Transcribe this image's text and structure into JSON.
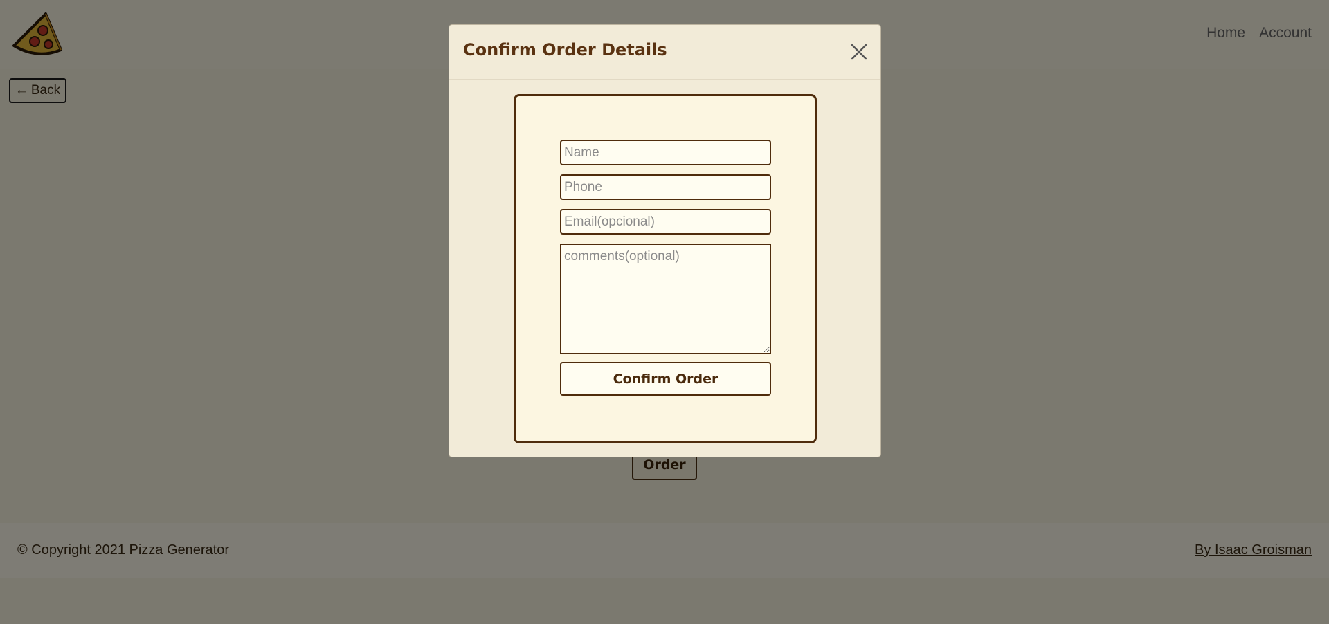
{
  "nav": {
    "links": [
      "Home",
      "Account"
    ]
  },
  "page": {
    "back_arrow": "←",
    "back_label": "Back",
    "order_label": "Order"
  },
  "footer": {
    "copyright": "© Copyright 2021 Pizza Generator",
    "author": "By Isaac Groisman"
  },
  "modal": {
    "title": "Confirm Order Details",
    "form": {
      "name_placeholder": "Name",
      "phone_placeholder": "Phone",
      "email_placeholder": "Email(opcional)",
      "comments_placeholder": "comments(optional)",
      "confirm_label": "Confirm Order"
    }
  },
  "colors": {
    "brand_brown": "#4f2c0c",
    "modal_bg": "#f2ebd8",
    "card_bg": "#fcf6e1",
    "page_bg": "#f7f2de"
  },
  "icons": {
    "logo": "pizza-slice-icon",
    "close": "close-icon"
  }
}
